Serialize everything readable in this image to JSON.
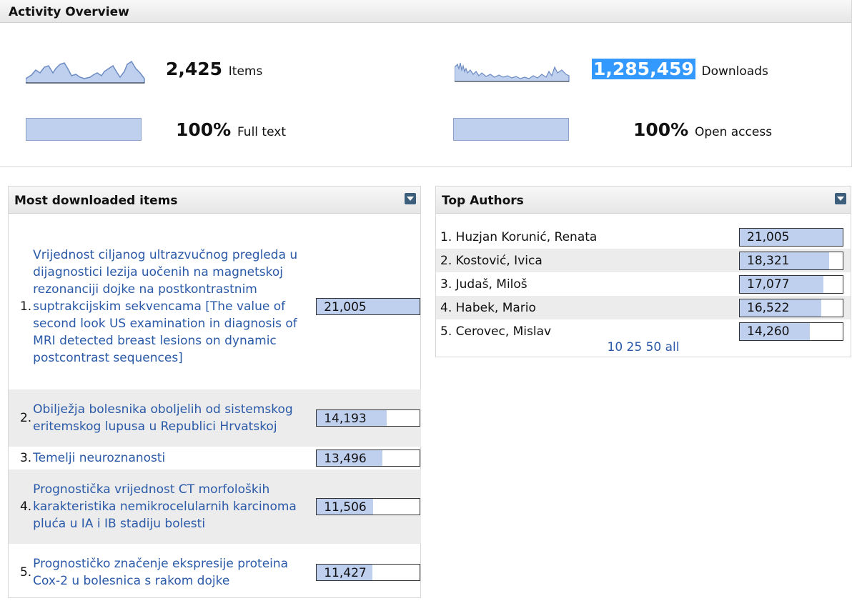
{
  "activity": {
    "title": "Activity Overview",
    "items": {
      "value": "2,425",
      "label": "Items"
    },
    "downloads": {
      "value": "1,285,459",
      "label": "Downloads"
    },
    "fulltext": {
      "value": "100%",
      "label": "Full text",
      "fraction": 1.0
    },
    "openaccess": {
      "value": "100%",
      "label": "Open access",
      "fraction": 1.0
    }
  },
  "most_downloaded": {
    "title": "Most downloaded items",
    "toggle_icon": "dropdown-toggle-icon",
    "rows": [
      {
        "num": "1.",
        "title": "Vrijednost ciljanog ultrazvučnog pregleda u dijagnostici lezija uočenih na magnetskoj rezonanciji dojke na postkontrastnim suptrakcijskim sekvencama [The value of second look US examination in diagnosis of MRI detected breast lesions on dynamic postcontrast sequences]",
        "count": "21,005",
        "fraction": 1.0
      },
      {
        "num": "2.",
        "title": "Obilježja bolesnika oboljelih od sistemskog eritemskog lupusa u Republici Hrvatskoj",
        "count": "14,193",
        "fraction": 0.68
      },
      {
        "num": "3.",
        "title": "Temelji neuroznanosti",
        "count": "13,496",
        "fraction": 0.64
      },
      {
        "num": "4.",
        "title": "Prognostička vrijednost CT morfoloških karakteristika nemikrocelularnih karcinoma pluća u IA i IB stadiju bolesti",
        "count": "11,506",
        "fraction": 0.55
      },
      {
        "num": "5.",
        "title": "Prognostičko značenje ekspresije proteina Cox-2 u bolesnica s rakom dojke",
        "count": "11,427",
        "fraction": 0.54
      }
    ]
  },
  "top_authors": {
    "title": "Top Authors",
    "toggle_icon": "dropdown-toggle-icon",
    "rows": [
      {
        "name": "1. Huzjan Korunić, Renata",
        "count": "21,005",
        "fraction": 1.0
      },
      {
        "name": "2. Kostović, Ivica",
        "count": "18,321",
        "fraction": 0.87
      },
      {
        "name": "3. Judaš, Miloš",
        "count": "17,077",
        "fraction": 0.81
      },
      {
        "name": "4. Habek, Mario",
        "count": "16,522",
        "fraction": 0.79
      },
      {
        "name": "5. Cerovec, Mislav",
        "count": "14,260",
        "fraction": 0.68
      }
    ],
    "pager": "10 25 50 all"
  },
  "colors": {
    "bar_fill": "#bfcfee",
    "link": "#2a59a8",
    "highlight": "#3399ff",
    "toggle": "#3e5f7c"
  }
}
